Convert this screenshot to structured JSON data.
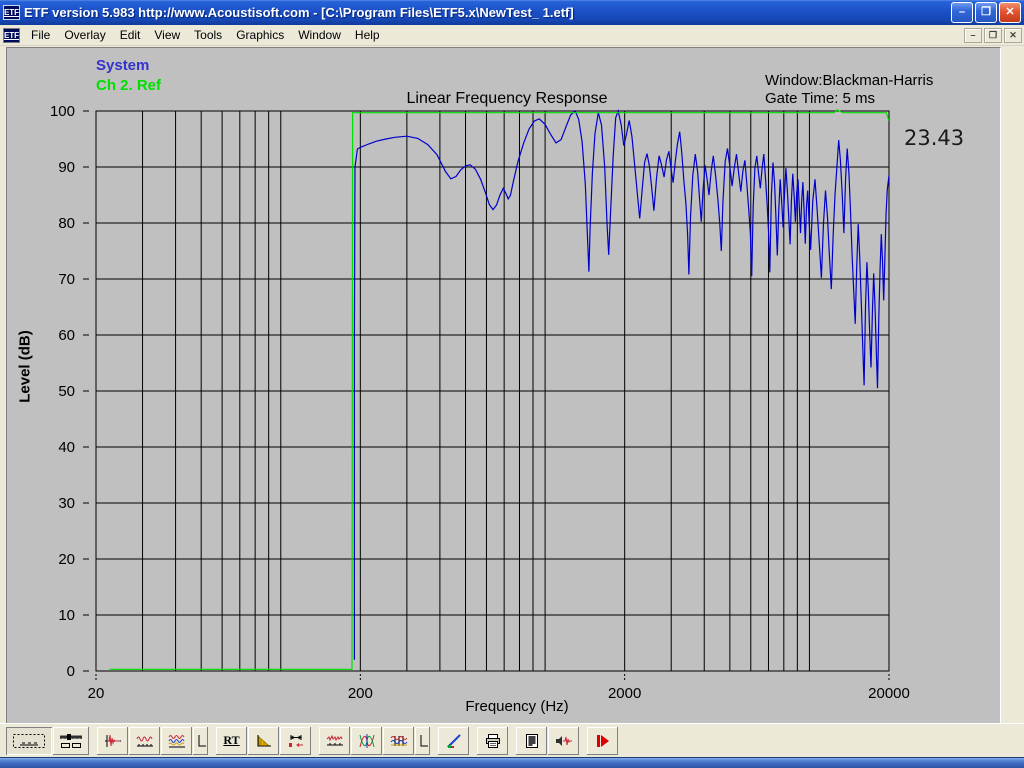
{
  "window": {
    "title": "ETF version 5.983 http://www.Acoustisoft.com - [C:\\Program Files\\ETF5.x\\NewTest_ 1.etf]",
    "app_icon_text": "ETF",
    "controls": {
      "minimize": "–",
      "restore": "❐",
      "close": "✕"
    }
  },
  "menu": {
    "items": [
      "File",
      "Overlay",
      "Edit",
      "View",
      "Tools",
      "Graphics",
      "Window",
      "Help"
    ],
    "mdi_controls": {
      "minimize": "–",
      "restore": "❐",
      "close": "✕"
    }
  },
  "chart": {
    "title": "Linear Frequency Response",
    "legend": [
      {
        "label": "System",
        "color": "#3333cc"
      },
      {
        "label": "Ch 2. Ref",
        "color": "#00e000"
      }
    ],
    "window_info": "Window:Blackman-Harris",
    "gate_info": "Gate Time: 5 ms",
    "side_value": "23.43",
    "xlabel": "Frequency (Hz)",
    "ylabel": "Level (dB)"
  },
  "chart_data": {
    "type": "line",
    "title": "Linear Frequency Response",
    "xlabel": "Frequency (Hz)",
    "ylabel": "Level (dB)",
    "x_scale": "log",
    "xlim": [
      20,
      20000
    ],
    "ylim": [
      0,
      100
    ],
    "grid": true,
    "grid_color": "#000000",
    "background": "#c0c0c0",
    "x_gridlines": [
      20,
      30,
      40,
      50,
      60,
      70,
      80,
      90,
      100,
      200,
      300,
      400,
      500,
      600,
      700,
      800,
      900,
      1000,
      2000,
      3000,
      4000,
      5000,
      6000,
      7000,
      8000,
      9000,
      10000,
      20000
    ],
    "x_ticks_labeled": [
      "20",
      "200",
      "2000",
      "20000"
    ],
    "x_tick_values": [
      20,
      200,
      2000,
      20000
    ],
    "y_ticks": [
      0,
      10,
      20,
      30,
      40,
      50,
      60,
      70,
      80,
      90,
      100
    ],
    "legend_position": "top-left",
    "series": [
      {
        "name": "System",
        "color": "#0000cc",
        "points": [
          [
            190,
            2
          ],
          [
            190,
            60
          ],
          [
            191,
            90
          ],
          [
            195,
            93.2
          ],
          [
            200,
            93.5
          ],
          [
            215,
            94.1
          ],
          [
            230,
            94.6
          ],
          [
            250,
            95.0
          ],
          [
            270,
            95.3
          ],
          [
            300,
            95.5
          ],
          [
            330,
            95.1
          ],
          [
            360,
            94.0
          ],
          [
            390,
            92.2
          ],
          [
            420,
            89.2
          ],
          [
            440,
            87.9
          ],
          [
            460,
            88.3
          ],
          [
            480,
            89.5
          ],
          [
            500,
            90.2
          ],
          [
            520,
            90.4
          ],
          [
            545,
            89.6
          ],
          [
            570,
            87.8
          ],
          [
            595,
            85.4
          ],
          [
            615,
            83.3
          ],
          [
            635,
            82.4
          ],
          [
            655,
            83.2
          ],
          [
            675,
            85.0
          ],
          [
            695,
            86.2
          ],
          [
            710,
            85.3
          ],
          [
            725,
            84.3
          ],
          [
            740,
            85.0
          ],
          [
            760,
            87.6
          ],
          [
            790,
            91.0
          ],
          [
            830,
            94.3
          ],
          [
            870,
            96.8
          ],
          [
            910,
            98.2
          ],
          [
            950,
            98.6
          ],
          [
            1000,
            97.6
          ],
          [
            1050,
            95.8
          ],
          [
            1100,
            94.3
          ],
          [
            1150,
            94.9
          ],
          [
            1200,
            97.2
          ],
          [
            1250,
            99.3
          ],
          [
            1300,
            100.0
          ],
          [
            1340,
            98.5
          ],
          [
            1380,
            94.5
          ],
          [
            1420,
            87.0
          ],
          [
            1450,
            76.5
          ],
          [
            1465,
            71.3
          ],
          [
            1480,
            79.0
          ],
          [
            1510,
            89.0
          ],
          [
            1545,
            96.0
          ],
          [
            1590,
            99.7
          ],
          [
            1635,
            97.5
          ],
          [
            1680,
            90.0
          ],
          [
            1715,
            80.0
          ],
          [
            1740,
            74.3
          ],
          [
            1770,
            82.0
          ],
          [
            1810,
            92.0
          ],
          [
            1850,
            98.8
          ],
          [
            1890,
            100.0
          ],
          [
            1940,
            97.5
          ],
          [
            1985,
            93.8
          ],
          [
            2030,
            95.8
          ],
          [
            2080,
            98.3
          ],
          [
            2130,
            95.5
          ],
          [
            2180,
            90.5
          ],
          [
            2230,
            85.5
          ],
          [
            2280,
            80.8
          ],
          [
            2330,
            86.0
          ],
          [
            2380,
            90.8
          ],
          [
            2430,
            92.4
          ],
          [
            2480,
            90.2
          ],
          [
            2530,
            86.3
          ],
          [
            2580,
            82.2
          ],
          [
            2640,
            88.0
          ],
          [
            2700,
            92.0
          ],
          [
            2760,
            90.3
          ],
          [
            2820,
            88.2
          ],
          [
            2880,
            91.3
          ],
          [
            2940,
            92.8
          ],
          [
            3000,
            89.5
          ],
          [
            3050,
            87.2
          ],
          [
            3110,
            91.0
          ],
          [
            3170,
            94.2
          ],
          [
            3230,
            96.3
          ],
          [
            3290,
            92.5
          ],
          [
            3350,
            87.5
          ],
          [
            3410,
            83.5
          ],
          [
            3460,
            78.0
          ],
          [
            3500,
            70.8
          ],
          [
            3550,
            81.0
          ],
          [
            3620,
            88.5
          ],
          [
            3700,
            92.3
          ],
          [
            3780,
            89.0
          ],
          [
            3840,
            84.2
          ],
          [
            3900,
            80.2
          ],
          [
            3960,
            86.0
          ],
          [
            4030,
            90.3
          ],
          [
            4100,
            87.8
          ],
          [
            4170,
            85.0
          ],
          [
            4250,
            89.3
          ],
          [
            4330,
            92.0
          ],
          [
            4420,
            88.3
          ],
          [
            4510,
            84.0
          ],
          [
            4580,
            79.8
          ],
          [
            4640,
            75.0
          ],
          [
            4710,
            84.0
          ],
          [
            4800,
            91.0
          ],
          [
            4900,
            93.3
          ],
          [
            5000,
            90.0
          ],
          [
            5100,
            86.6
          ],
          [
            5200,
            90.0
          ],
          [
            5300,
            92.3
          ],
          [
            5400,
            88.8
          ],
          [
            5500,
            85.6
          ],
          [
            5600,
            89.3
          ],
          [
            5700,
            91.2
          ],
          [
            5800,
            86.8
          ],
          [
            5900,
            82.0
          ],
          [
            5980,
            78.0
          ],
          [
            6050,
            70.5
          ],
          [
            6130,
            83.0
          ],
          [
            6220,
            89.8
          ],
          [
            6320,
            92.0
          ],
          [
            6420,
            88.8
          ],
          [
            6520,
            86.2
          ],
          [
            6620,
            89.8
          ],
          [
            6720,
            92.3
          ],
          [
            6820,
            88.0
          ],
          [
            6920,
            83.2
          ],
          [
            7000,
            78.6
          ],
          [
            7080,
            71.2
          ],
          [
            7180,
            85.0
          ],
          [
            7280,
            90.8
          ],
          [
            7380,
            87.0
          ],
          [
            7480,
            80.2
          ],
          [
            7560,
            74.2
          ],
          [
            7650,
            82.0
          ],
          [
            7750,
            87.8
          ],
          [
            7850,
            84.0
          ],
          [
            7950,
            79.2
          ],
          [
            8050,
            85.0
          ],
          [
            8150,
            89.8
          ],
          [
            8250,
            86.0
          ],
          [
            8350,
            81.2
          ],
          [
            8450,
            76.2
          ],
          [
            8550,
            84.0
          ],
          [
            8650,
            88.8
          ],
          [
            8750,
            85.0
          ],
          [
            8850,
            80.2
          ],
          [
            8950,
            85.4
          ],
          [
            9050,
            87.8
          ],
          [
            9150,
            83.2
          ],
          [
            9250,
            78.2
          ],
          [
            9350,
            84.0
          ],
          [
            9450,
            87.3
          ],
          [
            9550,
            82.2
          ],
          [
            9650,
            76.3
          ],
          [
            9750,
            83.0
          ],
          [
            9850,
            85.8
          ],
          [
            9950,
            81.0
          ],
          [
            10100,
            75.2
          ],
          [
            10300,
            84.0
          ],
          [
            10500,
            87.8
          ],
          [
            10700,
            82.2
          ],
          [
            10900,
            76.2
          ],
          [
            11100,
            70.2
          ],
          [
            11300,
            80.0
          ],
          [
            11500,
            85.8
          ],
          [
            11700,
            81.0
          ],
          [
            11900,
            74.2
          ],
          [
            12100,
            68.2
          ],
          [
            12300,
            78.0
          ],
          [
            12500,
            85.0
          ],
          [
            12700,
            90.0
          ],
          [
            12900,
            94.8
          ],
          [
            13100,
            91.2
          ],
          [
            13300,
            85.2
          ],
          [
            13500,
            78.2
          ],
          [
            13700,
            88.0
          ],
          [
            13900,
            93.3
          ],
          [
            14100,
            89.0
          ],
          [
            14300,
            82.2
          ],
          [
            14500,
            74.2
          ],
          [
            14700,
            68.0
          ],
          [
            14900,
            62.0
          ],
          [
            15100,
            72.0
          ],
          [
            15300,
            79.8
          ],
          [
            15500,
            74.0
          ],
          [
            15700,
            66.2
          ],
          [
            15900,
            58.2
          ],
          [
            16100,
            51.0
          ],
          [
            16300,
            65.0
          ],
          [
            16500,
            73.0
          ],
          [
            16700,
            68.0
          ],
          [
            16900,
            60.2
          ],
          [
            17100,
            54.2
          ],
          [
            17300,
            64.0
          ],
          [
            17500,
            71.0
          ],
          [
            17700,
            65.2
          ],
          [
            17900,
            57.2
          ],
          [
            18100,
            50.5
          ],
          [
            18300,
            63.0
          ],
          [
            18500,
            72.0
          ],
          [
            18700,
            78.0
          ],
          [
            18900,
            73.2
          ],
          [
            19100,
            66.2
          ],
          [
            19300,
            74.0
          ],
          [
            19500,
            81.8
          ],
          [
            19700,
            86.0
          ],
          [
            20000,
            88.5
          ]
        ]
      },
      {
        "name": "Ch 2. Ref",
        "color": "#00e000",
        "points": [
          [
            22.5,
            0.3
          ],
          [
            186,
            0.3
          ],
          [
            187,
            99.7
          ],
          [
            12400,
            99.7
          ],
          [
            12700,
            100.2
          ],
          [
            13400,
            99.7
          ],
          [
            19500,
            99.7
          ],
          [
            20000,
            98.3
          ]
        ]
      }
    ],
    "annotations": [
      {
        "text": "Window:Blackman-Harris",
        "position": "top-right"
      },
      {
        "text": "Gate Time: 5 ms",
        "position": "top-right"
      },
      {
        "text": "23.43",
        "position": "right-of-plot"
      }
    ]
  },
  "toolbar": {
    "rt_label": "RT",
    "buttons": [
      {
        "name": "select-region-button",
        "icon": "dashed-marquee-icon",
        "pressed": true
      },
      {
        "name": "window-settings-button",
        "icon": "slider-boxes-icon"
      },
      {
        "name": "impulse-response-button",
        "icon": "impulse-spike-icon"
      },
      {
        "name": "frequency-response-button",
        "icon": "red-wave-axis-icon"
      },
      {
        "name": "overlay-responses-button",
        "icon": "multi-wave-icon"
      },
      {
        "name": "axis-scale-button-1",
        "icon": "axis-corner-icon"
      },
      {
        "name": "rt-button",
        "icon": "rt-text"
      },
      {
        "name": "energy-decay-button",
        "icon": "yellow-decay-icon"
      },
      {
        "name": "gate-time-button",
        "icon": "gate-arrows-icon"
      },
      {
        "name": "noise-level-button",
        "icon": "jagged-wave-icon"
      },
      {
        "name": "phase-response-button",
        "icon": "rgb-curves-icon"
      },
      {
        "name": "spectrum-overlay-button",
        "icon": "bars-waves-icon"
      },
      {
        "name": "axis-scale-button-2",
        "icon": "axis-corner-icon"
      },
      {
        "name": "color-settings-button",
        "icon": "pencil-colors-icon"
      },
      {
        "name": "print-button",
        "icon": "printer-icon"
      },
      {
        "name": "report-button",
        "icon": "document-icon"
      },
      {
        "name": "speaker-test-button",
        "icon": "speaker-wave-icon"
      },
      {
        "name": "run-measurement-button",
        "icon": "red-play-icon"
      }
    ]
  }
}
